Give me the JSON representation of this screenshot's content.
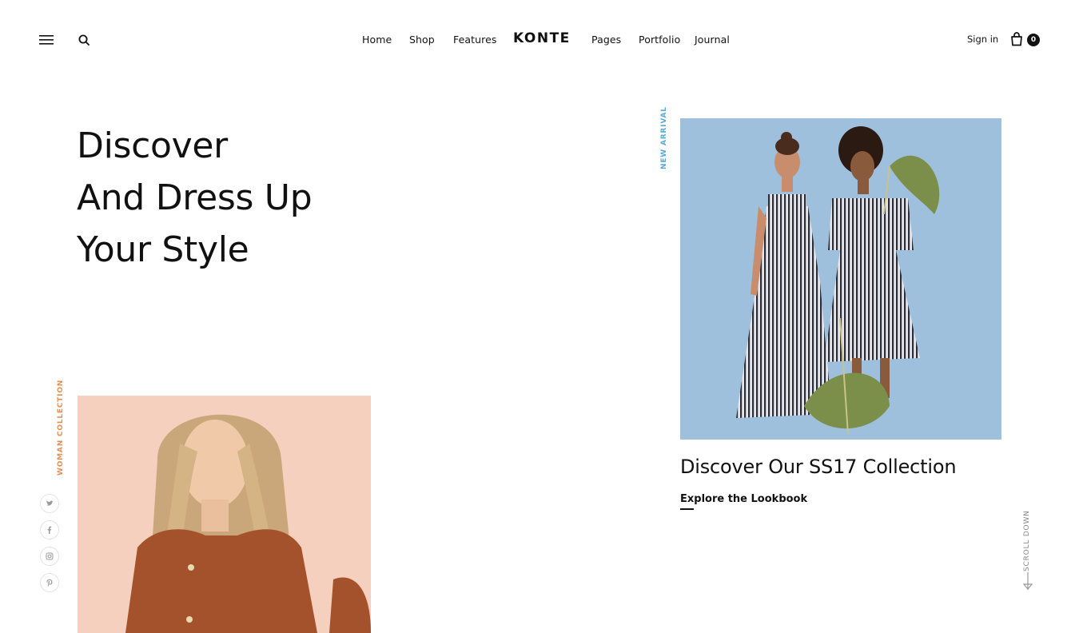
{
  "brand": {
    "logo_text": "KONTE"
  },
  "nav": {
    "items": [
      {
        "label": "Home"
      },
      {
        "label": "Shop"
      },
      {
        "label": "Features"
      },
      {
        "label": "Pages"
      },
      {
        "label": "Portfolio"
      },
      {
        "label": "Journal"
      }
    ]
  },
  "header": {
    "menu_icon": "hamburger-menu-icon",
    "search_icon": "search-icon",
    "signin_label": "Sign in",
    "cart_icon": "shopping-bag-icon",
    "cart_count": "0"
  },
  "hero": {
    "lines": [
      "Discover",
      "And Dress Up",
      "Your Style"
    ]
  },
  "featured": {
    "label": "NEW ARRIVAL",
    "label_color": "#5aa8d6",
    "title": "Discover Our SS17 Collection",
    "link_label": "Explore the Lookbook",
    "image_desc_icon": "models-striped-dresses-image"
  },
  "secondary": {
    "label": "WOMAN COLLECTION",
    "label_color": "#e0915a",
    "image_icon": "woman-portrait-image"
  },
  "social": [
    {
      "icon": "twitter-icon"
    },
    {
      "icon": "facebook-icon"
    },
    {
      "icon": "instagram-icon"
    },
    {
      "icon": "pinterest-icon"
    }
  ],
  "scroll": {
    "label": "SCROLL DOWN",
    "icon": "arrow-down-icon"
  }
}
